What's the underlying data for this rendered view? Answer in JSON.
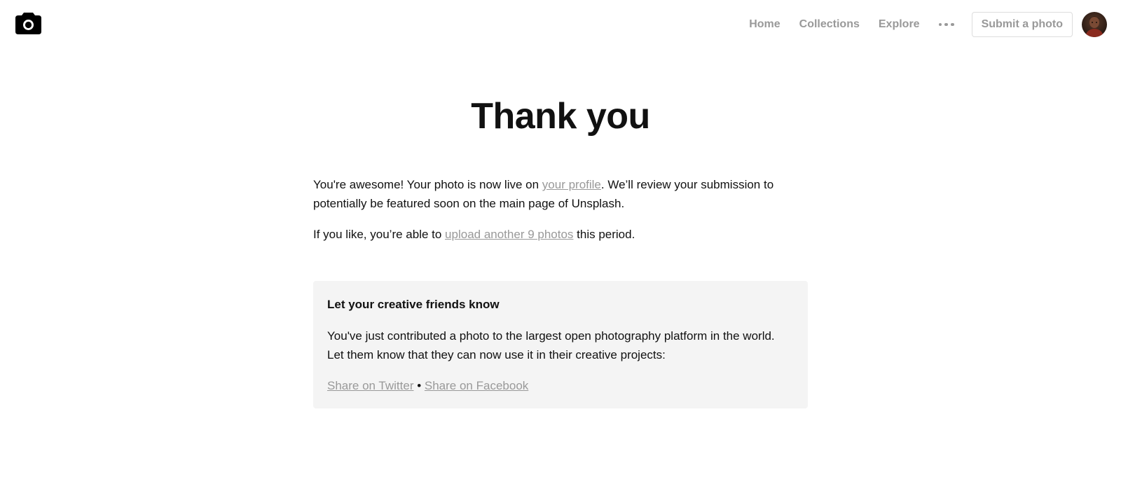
{
  "header": {
    "nav": {
      "home_label": "Home",
      "collections_label": "Collections",
      "explore_label": "Explore",
      "more_icon": "ellipsis-icon",
      "submit_label": "Submit a photo"
    },
    "logo_icon": "camera-icon",
    "avatar_icon": "user-avatar"
  },
  "main": {
    "title": "Thank you",
    "intro": {
      "p1_before": "You're awesome! Your photo is now live on ",
      "p1_link": "your profile",
      "p1_after": ". We’ll review your submission to potentially be featured soon on the main page of Unsplash.",
      "p2_before": "If you like, you’re able to ",
      "p2_link": "upload another 9 photos",
      "p2_after": " this period."
    },
    "share": {
      "heading": "Let your creative friends know",
      "text": "You've just contributed a photo to the largest open photography platform in the world. Let them know that they can now use it in their creative projects:",
      "twitter_label": "Share on Twitter",
      "separator": " • ",
      "facebook_label": "Share on Facebook"
    }
  },
  "colors": {
    "text": "#111111",
    "muted": "#999999",
    "panel_bg": "#f4f4f4",
    "border": "#dddddd"
  }
}
